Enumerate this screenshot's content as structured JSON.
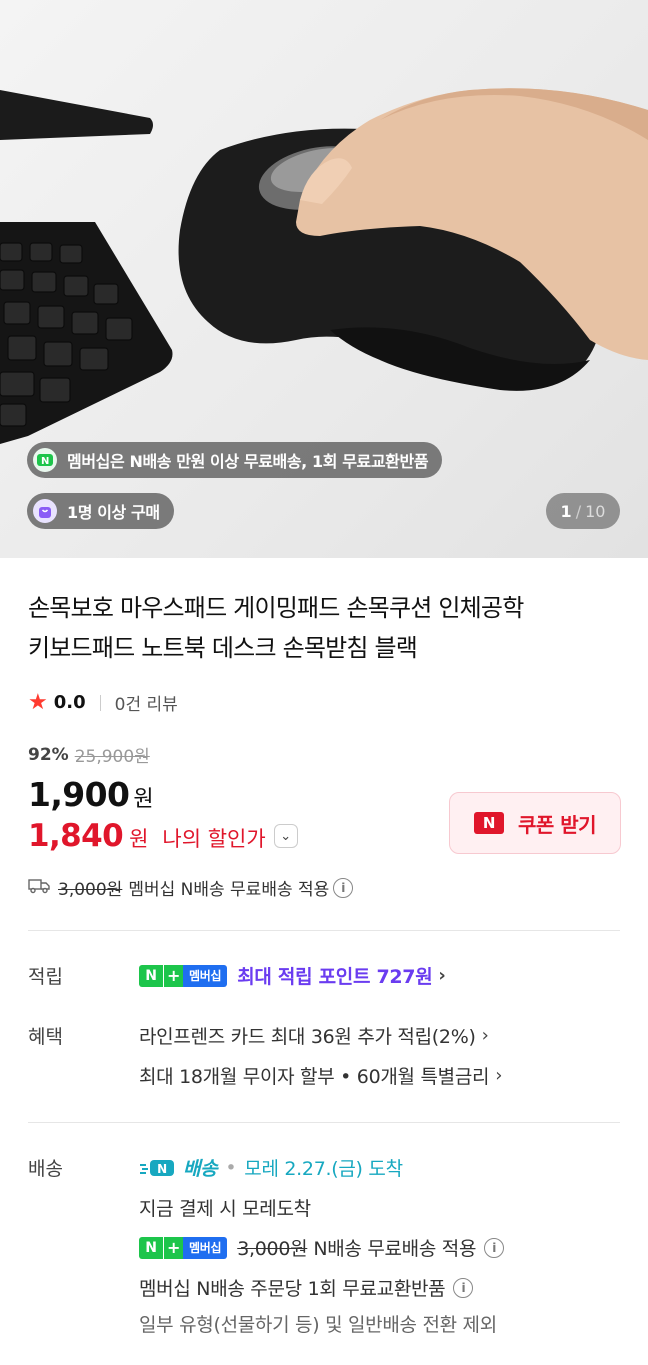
{
  "hero": {
    "ship_badge": "멤버십은 N배송 만원 이상 무료배송, 1회 무료교환반품",
    "buy_badge": "1명 이상 구매",
    "counter_current": "1",
    "counter_sep": "/",
    "counter_total": "10"
  },
  "product": {
    "title_line1": "손목보호 마우스패드 게이밍패드 손목쿠션 인체공학",
    "title_line2": "키보드패드 노트북 데스크 손목받침 블랙",
    "rating": "0.0",
    "review_count": "0건 리뷰"
  },
  "price": {
    "discount_pct": "92%",
    "original": "25,900원",
    "sale": "1,900",
    "sale_unit": "원",
    "my_price": "1,840",
    "my_price_unit": "원",
    "my_price_label": "나의 할인가",
    "coupon_label": "쿠폰 받기",
    "coupon_badge": "N",
    "ship_fee_strike": "3,000원",
    "ship_text": "멤버십 N배송 무료배송 적용"
  },
  "rows": {
    "reward_label": "적립",
    "reward_text": "최대 적립 포인트 727원",
    "benefit_label": "혜택",
    "benefit_1": "라인프렌즈 카드 최대 36원 추가 적립(2%)",
    "benefit_2": "최대 18개월 무이자 할부 • 60개월 특별금리",
    "delivery_label": "배송",
    "delivery_brand": "배송",
    "delivery_eta": "모레 2.27.(금) 도착",
    "delivery_note": "지금 결제 시 모레도착",
    "delivery_fee_strike": "3,000원",
    "delivery_fee_text": "N배송 무료배송 적용",
    "delivery_exchange": "멤버십 N배송 주문당 1회 무료교환반품",
    "delivery_exclude": "일부 유형(선물하기 등) 및 일반배송 전환 제외"
  },
  "badge": {
    "n": "N",
    "plus": "+",
    "membership": "멤버십"
  },
  "colors": {
    "accent_red": "#e0162b",
    "point_purple": "#6a3cf0",
    "nship_teal": "#17a8c0",
    "npay_green": "#1dc54b"
  }
}
